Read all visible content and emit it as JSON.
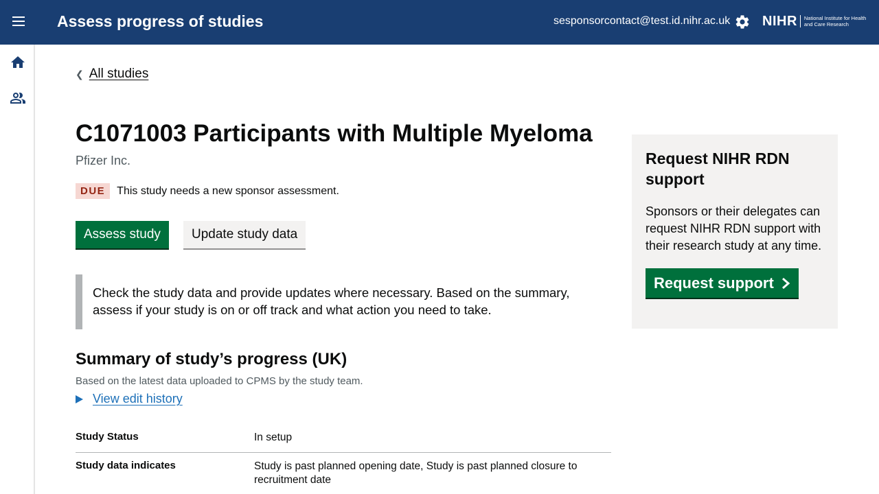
{
  "header": {
    "app_title": "Assess progress of studies",
    "user_email": "sesponsorcontact@test.id.nihr.ac.uk",
    "logo_mark": "NIHR",
    "logo_text": "National Institute for Health and Care Research",
    "icons": [
      "menu-icon",
      "gear-icon"
    ]
  },
  "sidebar": {
    "items": [
      {
        "icon": "home-icon"
      },
      {
        "icon": "people-icon"
      }
    ]
  },
  "breadcrumb": {
    "back_label": "All studies"
  },
  "study": {
    "title": "C1071003 Participants with Multiple Myeloma",
    "sponsor": "Pfizer Inc.",
    "status_tag": "DUE",
    "status_text": "This study needs a new sponsor assessment."
  },
  "actions": {
    "assess_label": "Assess study",
    "update_label": "Update study data"
  },
  "inset_text": "Check the study data and provide updates where necessary. Based on the summary, assess if your study is on or off track and what action you need to take.",
  "summary": {
    "title": "Summary of study’s progress (UK)",
    "hint": "Based on the latest data uploaded to CPMS by the study team.",
    "history_label": "View edit history",
    "rows": [
      {
        "key": "Study Status",
        "value": "In setup"
      },
      {
        "key": "Study data indicates",
        "value": "Study is past planned opening date, Study is past planned closure to recruitment date"
      }
    ]
  },
  "support_panel": {
    "title": "Request NIHR RDN support",
    "body": "Sponsors or their delegates can request NIHR RDN support with their research study at any time.",
    "button_label": "Request support"
  },
  "colors": {
    "header_bg": "#193e72",
    "primary_green": "#00703c",
    "link_blue": "#1d70b8",
    "due_bg": "#f6d7d2",
    "due_text": "#942514"
  }
}
